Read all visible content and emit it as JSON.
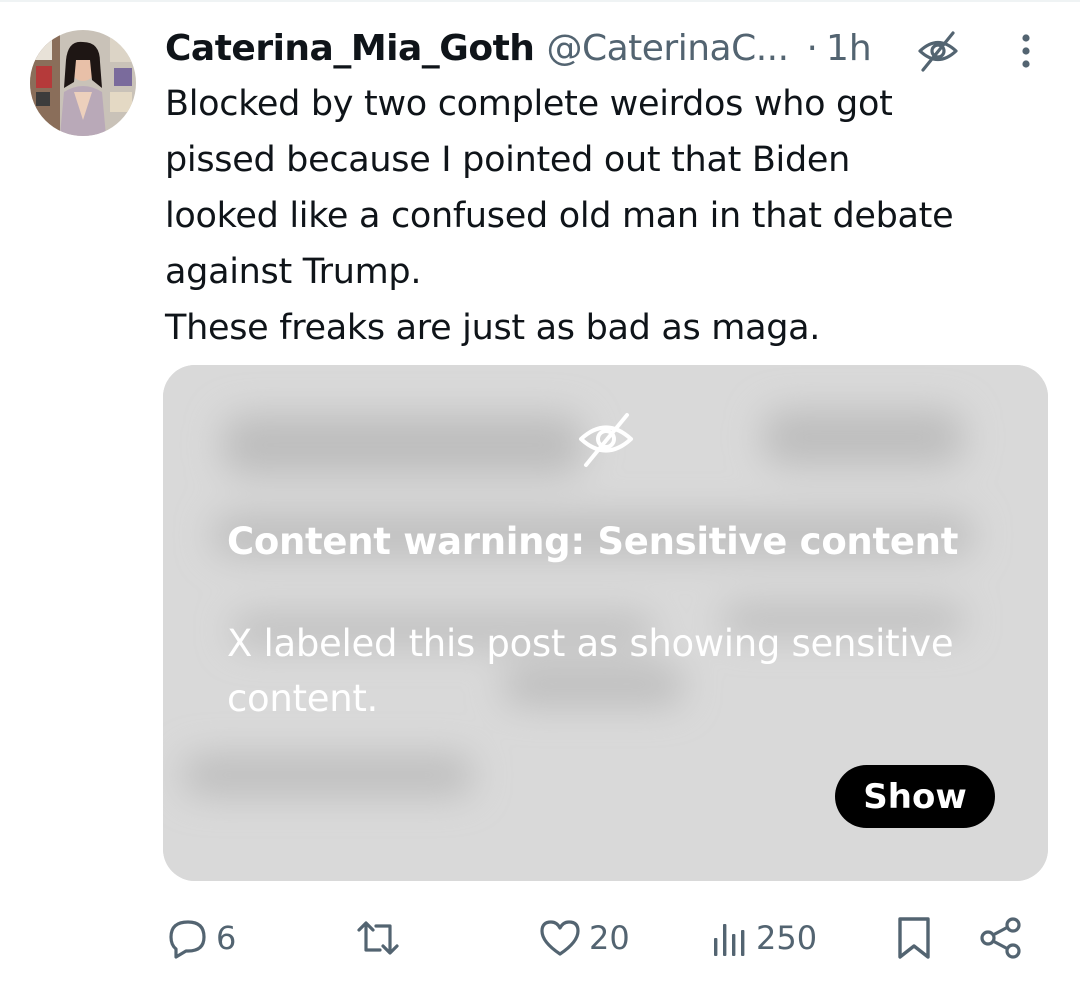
{
  "post": {
    "author": {
      "display_name": "Caterina_Mia_Goth",
      "handle": "@CaterinaC...",
      "separator": "·",
      "time": "1h"
    },
    "text_lines": [
      "Blocked by two complete weirdos who got",
      "pissed because I pointed out that Biden",
      "looked like a confused old man in that debate",
      "against Trump.",
      "These freaks are just as bad as maga."
    ],
    "media": {
      "warning_title": "Content warning: Sensitive content",
      "warning_description": "X labeled this post as showing sensitive content.",
      "show_label": "Show"
    },
    "actions": {
      "replies": "6",
      "reposts": "",
      "likes": "20",
      "views": "250"
    }
  },
  "icons": {
    "reply": "reply-icon",
    "repost": "repost-icon",
    "like": "heart-icon",
    "views": "views-icon",
    "bookmark": "bookmark-icon",
    "share": "share-icon",
    "more": "more-icon",
    "sensitive": "eye-slash-icon"
  },
  "colors": {
    "text_primary": "#0f1419",
    "text_secondary": "#536471",
    "media_bg": "#d9d9d9",
    "button_bg": "#000000"
  }
}
